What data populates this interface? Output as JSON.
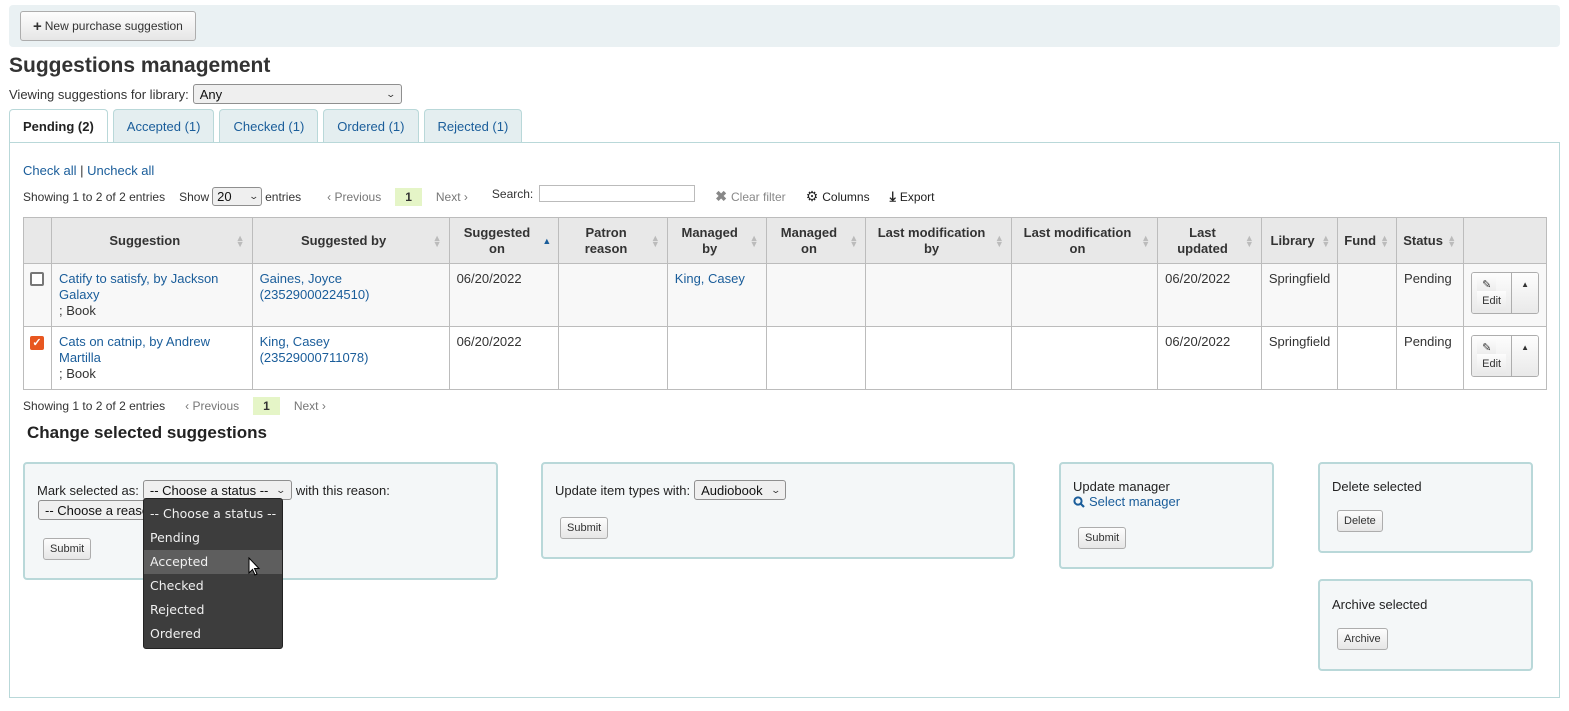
{
  "toolbar": {
    "new_suggestion_label": "New purchase suggestion"
  },
  "page_title": "Suggestions management",
  "library_filter": {
    "label": "Viewing suggestions for library:",
    "value": "Any"
  },
  "tabs": [
    {
      "label": "Pending (2)",
      "active": true
    },
    {
      "label": "Accepted (1)"
    },
    {
      "label": "Checked (1)"
    },
    {
      "label": "Ordered (1)"
    },
    {
      "label": "Rejected (1)"
    }
  ],
  "check_links": {
    "check_all": "Check all",
    "separator": "|",
    "uncheck_all": "Uncheck all"
  },
  "table_controls": {
    "info": "Showing 1 to 2 of 2 entries",
    "show_label": "Show",
    "page_size": "20",
    "entries_label": "entries",
    "previous": "Previous",
    "current_page": "1",
    "next": "Next",
    "search_label": "Search:",
    "search_value": "",
    "clear_filter": "Clear filter",
    "columns": "Columns",
    "export": "Export"
  },
  "table": {
    "headers": [
      "Suggestion",
      "Suggested by",
      "Suggested on",
      "Patron reason",
      "Managed by",
      "Managed on",
      "Last modification by",
      "Last modification on",
      "Last updated",
      "Library",
      "Fund",
      "Status"
    ],
    "rows": [
      {
        "checked": false,
        "suggestion_title": "Catify to satisfy, by Jackson Galaxy",
        "suggestion_type": "; Book",
        "suggested_by": "Gaines, Joyce (23529000224510)",
        "suggested_on": "06/20/2022",
        "patron_reason": "",
        "managed_by": "King, Casey",
        "managed_on": "",
        "last_mod_by": "",
        "last_mod_on": "",
        "last_updated": "06/20/2022",
        "library": "Springfield",
        "fund": "",
        "status": "Pending",
        "edit_label": "Edit"
      },
      {
        "checked": true,
        "suggestion_title": "Cats on catnip, by Andrew Martilla",
        "suggestion_type": "; Book",
        "suggested_by": "King, Casey (23529000711078)",
        "suggested_on": "06/20/2022",
        "patron_reason": "",
        "managed_by": "",
        "managed_on": "",
        "last_mod_by": "",
        "last_mod_on": "",
        "last_updated": "06/20/2022",
        "library": "Springfield",
        "fund": "",
        "status": "Pending",
        "edit_label": "Edit"
      }
    ]
  },
  "change_section": {
    "title": "Change selected suggestions",
    "mark": {
      "label": "Mark selected as:",
      "status_value": "-- Choose a status --",
      "reason_label": "with this reason:",
      "reason_value": "-- Choose a reason --",
      "submit": "Submit",
      "status_options": [
        "-- Choose a status --",
        "Pending",
        "Accepted",
        "Checked",
        "Rejected",
        "Ordered"
      ],
      "hovered_option": "Accepted"
    },
    "item_types": {
      "label": "Update item types with:",
      "value": "Audiobook",
      "submit": "Submit"
    },
    "manager": {
      "label": "Update manager",
      "select_link": "Select manager",
      "submit": "Submit"
    },
    "delete": {
      "label": "Delete selected",
      "button": "Delete"
    },
    "archive": {
      "label": "Archive selected",
      "button": "Archive"
    }
  }
}
